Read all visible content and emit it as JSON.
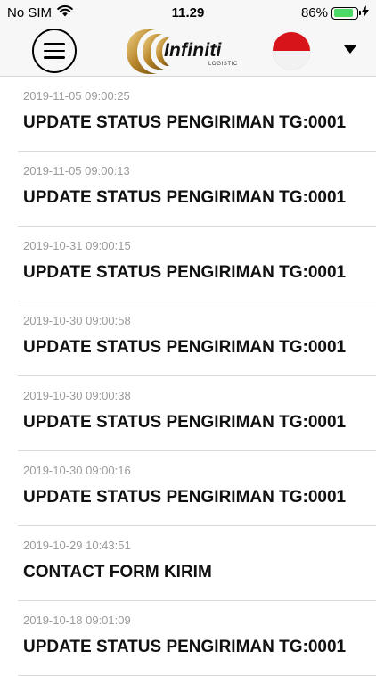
{
  "status_bar": {
    "carrier": "No SIM",
    "time": "11.29",
    "battery_percent": "86%",
    "battery_level": 0.86,
    "battery_color": "#4cd964",
    "wifi_icon": "wifi-icon",
    "charging_icon": "bolt-icon"
  },
  "header": {
    "menu_icon": "hamburger-menu-icon",
    "logo_name": "Infiniti",
    "logo_subtitle": "LOGISTIC",
    "flag": "indonesia-flag",
    "dropdown_icon": "caret-down-icon"
  },
  "notifications": [
    {
      "date": "2019-11-05 09:00:25",
      "title": "UPDATE STATUS PENGIRIMAN TG:0001"
    },
    {
      "date": "2019-11-05 09:00:13",
      "title": "UPDATE STATUS PENGIRIMAN TG:0001"
    },
    {
      "date": "2019-10-31 09:00:15",
      "title": "UPDATE STATUS PENGIRIMAN TG:0001"
    },
    {
      "date": "2019-10-30 09:00:58",
      "title": "UPDATE STATUS PENGIRIMAN TG:0001"
    },
    {
      "date": "2019-10-30 09:00:38",
      "title": "UPDATE STATUS PENGIRIMAN TG:0001"
    },
    {
      "date": "2019-10-30 09:00:16",
      "title": "UPDATE STATUS PENGIRIMAN TG:0001"
    },
    {
      "date": "2019-10-29 10:43:51",
      "title": "CONTACT FORM KIRIM"
    },
    {
      "date": "2019-10-18 09:01:09",
      "title": "UPDATE STATUS PENGIRIMAN TG:0001"
    }
  ]
}
